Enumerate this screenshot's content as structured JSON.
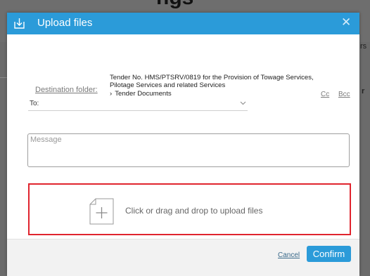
{
  "background": {
    "heading_fragment": "ngs",
    "side_text_top": "rs",
    "side_text_mid": "r"
  },
  "dialog": {
    "title": "Upload files",
    "header_icon": "upload-icon",
    "close_icon": "close-icon",
    "close_label": "✕"
  },
  "destination": {
    "label": "Destination folder:",
    "path": "Tender No. HMS/PTSRV/0819 for the Provision of Towage Services, Pilotage Services and related Services",
    "subfolder": "Tender Documents",
    "separator": "›"
  },
  "recipients": {
    "to_label": "To:",
    "cc_label": "Cc",
    "bcc_label": "Bcc"
  },
  "message": {
    "placeholder": "Message"
  },
  "dropzone": {
    "text": "Click or drag and drop to upload files",
    "icon": "file-add-icon",
    "border_color": "#e0242e"
  },
  "footer": {
    "cancel_label": "Cancel",
    "confirm_label": "Confirm"
  },
  "colors": {
    "accent": "#2b9bd9"
  }
}
